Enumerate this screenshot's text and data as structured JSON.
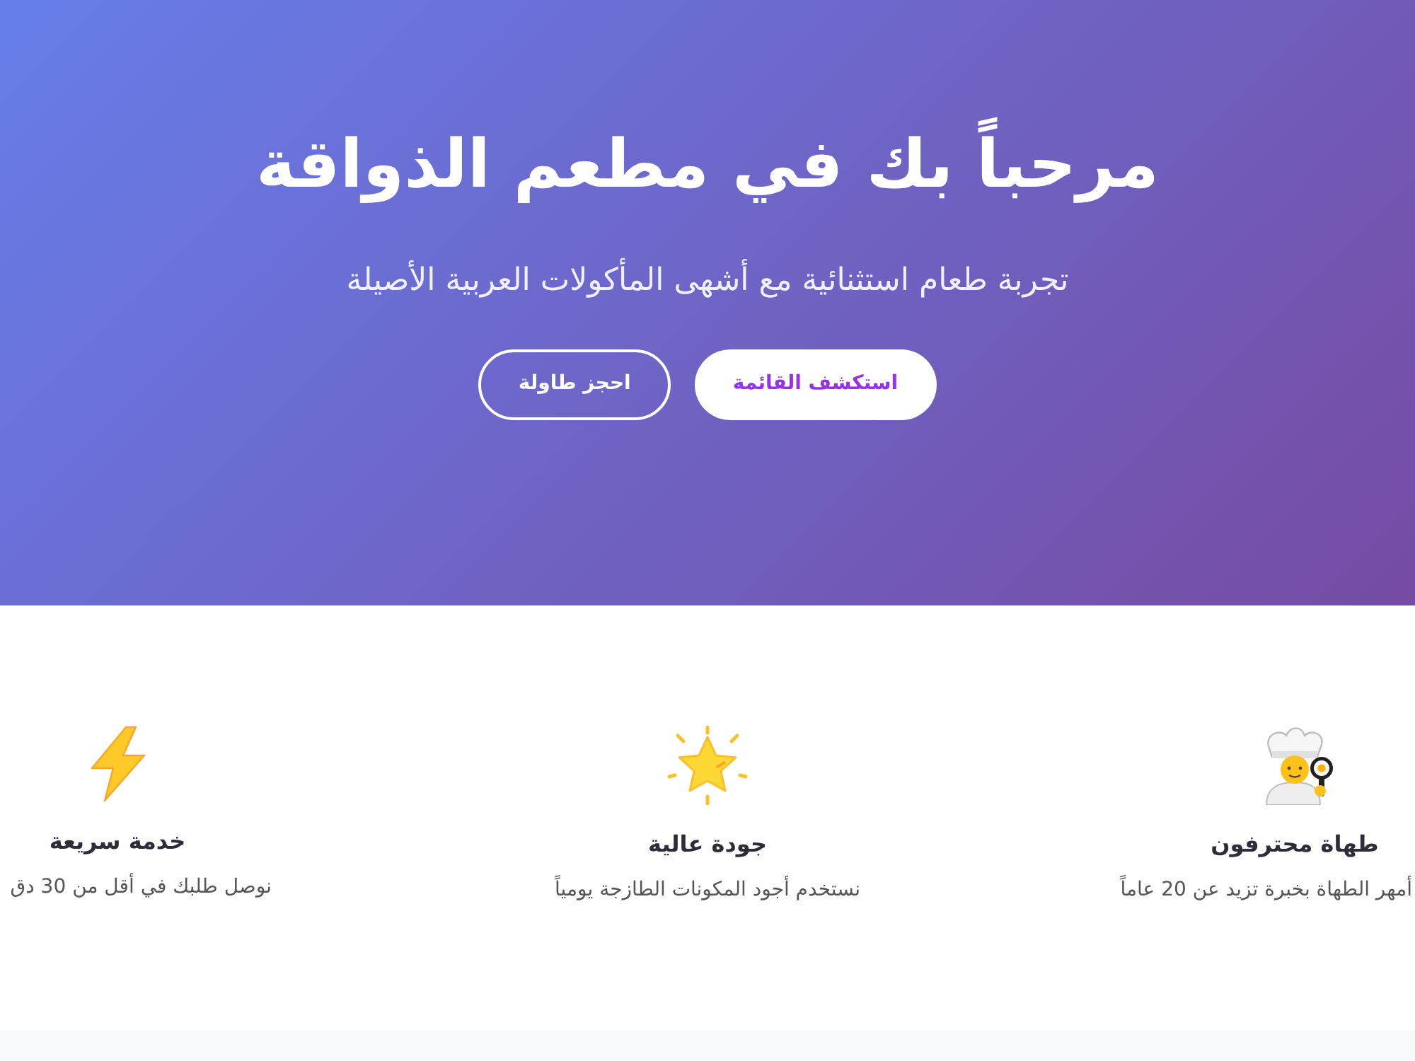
{
  "hero": {
    "title": "مرحباً بك في مطعم الذواقة",
    "subtitle": "تجربة طعام استثنائية مع أشهى المأكولات العربية الأصيلة",
    "buttons": [
      {
        "label": "استكشف القائمة",
        "kind": "primary"
      },
      {
        "label": "احجز طاولة",
        "kind": "outline"
      }
    ]
  },
  "features": [
    {
      "title": "طهاة محترفون",
      "description": "أمهر الطهاة بخبرة تزيد عن 20 عاماً"
    },
    {
      "title": "جودة عالية",
      "description": "نستخدم أجود المكونات الطازجة يومياً"
    },
    {
      "title": "خدمة سريعة",
      "description": "نوصل طلبك في أقل من 30 دق"
    }
  ]
}
